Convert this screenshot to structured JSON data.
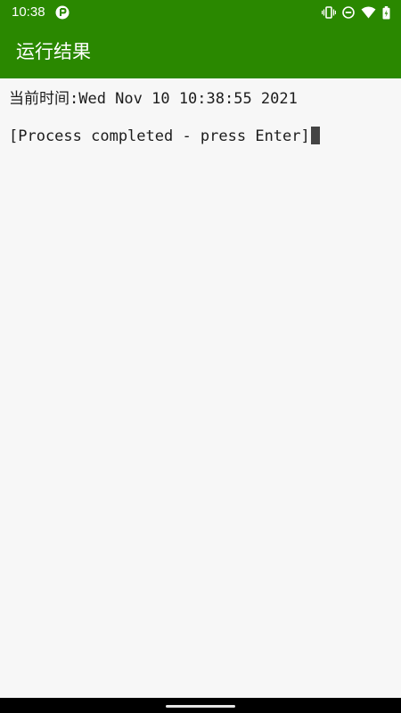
{
  "status_bar": {
    "time": "10:38",
    "icons": [
      "app-notification-icon",
      "vibrate-icon",
      "do-not-disturb-icon",
      "wifi-icon",
      "battery-icon"
    ]
  },
  "app_bar": {
    "title": "运行结果"
  },
  "terminal": {
    "lines": [
      "当前时间:Wed Nov 10 10:38:55 2021",
      "[Process completed - press Enter]"
    ]
  },
  "colors": {
    "app_bar": "#2a8800",
    "background": "#f7f7f7",
    "text": "#1c1c1c",
    "cursor": "#444444"
  }
}
